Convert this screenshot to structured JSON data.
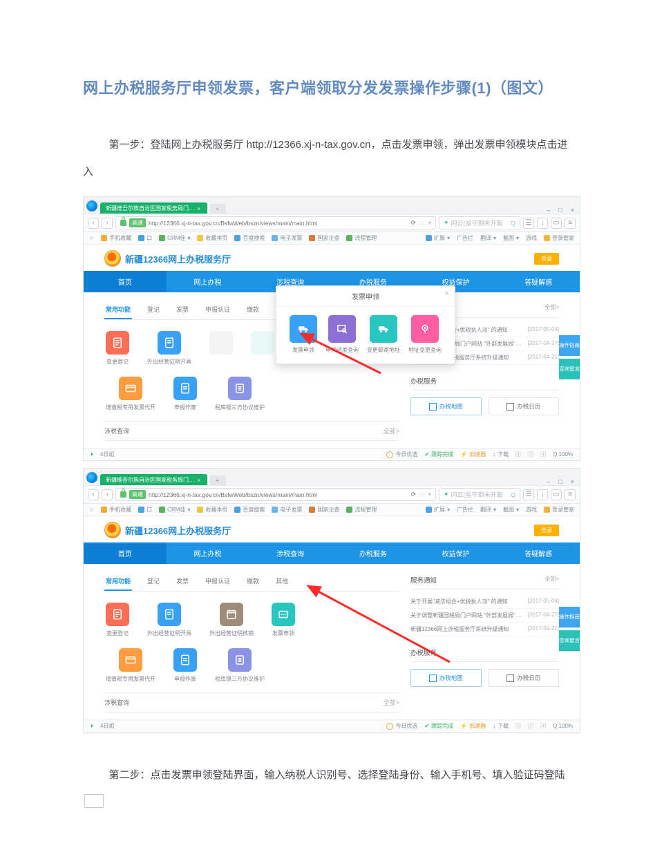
{
  "doc": {
    "title": "网上办税服务厅申领发票，客户端领取分发发票操作步骤(1)（图文）",
    "step1": "第一步：登陆网上办税服务厅 http://12366.xj-n-tax.gov.cn，点击发票申领，弹出发票申领模块点击进入",
    "step2": "第二步：点击发票申领登陆界面，输入纳税人识别号、选择登陆身份、输入手机号、填入验证码登陆"
  },
  "browser": {
    "tab_title": "新疆维吾尔族自治区国家税务局门…",
    "secondary_tab": "+",
    "url_label": "高速",
    "url": "http://12366.xj-n-tax.gov.cn/BsfwWeb/bszn/views/main/main.html",
    "search_placeholder": "网云(留守期末开篇",
    "nav_buttons": [
      "←",
      "→",
      "⟳",
      "≡"
    ],
    "right_glyphs": [
      "☰",
      "–",
      "□",
      "×"
    ],
    "toolbar_left": [
      "手机收藏",
      "口",
      "CRM佳",
      "收藏本页",
      "百度搜索",
      "电子发票",
      "国家企查",
      "流程管理"
    ],
    "toolbar_right": [
      "扩展",
      "广告拦",
      "翻译",
      "截图",
      "游戏",
      "登录管家"
    ]
  },
  "portal": {
    "title": "新疆12366网上办税服务厅",
    "welcome": "",
    "login": "登录",
    "nav": [
      "首页",
      "网上办税",
      "涉税查询",
      "办税服务",
      "权益保护",
      "答疑解惑"
    ],
    "subtabs": [
      "常用功能",
      "登记",
      "发票",
      "申报认证",
      "缴款",
      "其他"
    ],
    "row1": [
      {
        "label": "变更登记",
        "color": "c-red",
        "svg": "doc"
      },
      {
        "label": "外出经营证明开具",
        "color": "c-blue",
        "svg": "doc"
      },
      {
        "label": "外出经营证明核销",
        "color": "c-brown",
        "svg": "calendar"
      },
      {
        "label": "发票申领",
        "color": "c-cyan",
        "svg": "ticket"
      }
    ],
    "row2": [
      {
        "label": "增值税专用发票代开",
        "color": "c-orange",
        "svg": "card"
      },
      {
        "label": "申报作废",
        "color": "c-blue",
        "svg": "doc"
      },
      {
        "label": "税库银三方协议维护",
        "color": "c-lav",
        "svg": "list"
      }
    ],
    "popup_title": "发票申领",
    "popup_items": [
      {
        "label": "发票申领",
        "color": "c-blue",
        "svg": "truck"
      },
      {
        "label": "申领进度查询",
        "color": "c-viol",
        "svg": "search"
      },
      {
        "label": "变更邮寄地址",
        "color": "c-cyan",
        "svg": "truck"
      },
      {
        "label": "地址变更查询",
        "color": "c-mag",
        "svg": "pin"
      }
    ],
    "news_title": "服务通知",
    "news_more": "全部>",
    "news": [
      {
        "t": "关于开展\"减法组合+优税执人派\" 的通知",
        "d": "[2017-05-04]"
      },
      {
        "t": "关于调整新疆国税局门户网站 \"外部发展局\"…",
        "d": "[2017-04-27]"
      },
      {
        "t": "新疆12366网上办税服务厅系统升级通知",
        "d": "[2017-04-21]"
      }
    ],
    "svc_title": "办税服务",
    "svc_btns": [
      "办税地图",
      "办税日历"
    ],
    "inquire": "涉税查询",
    "inquire_more": "全部>",
    "float": [
      "操作指南",
      "咨询留言"
    ]
  },
  "status": {
    "left": "4日组",
    "center_info": "今日优选",
    "items": [
      "跟踪完成",
      "加速器",
      "下载",
      "匿",
      "匿",
      "匿",
      "Q 100%"
    ]
  }
}
